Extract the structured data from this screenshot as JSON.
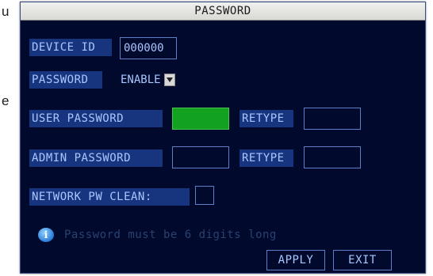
{
  "background_text": [
    "u",
    "e"
  ],
  "dialog": {
    "title": "PASSWORD",
    "device_id": {
      "label": "DEVICE ID",
      "value": "000000"
    },
    "password": {
      "label": "PASSWORD",
      "selected": "ENABLE"
    },
    "user_password": {
      "label": "USER PASSWORD",
      "retype_label": "RETYPE"
    },
    "admin_password": {
      "label": "ADMIN PASSWORD",
      "retype_label": "RETYPE"
    },
    "network_pw_clean": {
      "label": "NETWORK PW CLEAN:"
    },
    "info": {
      "icon": "info-icon",
      "glyph": "i",
      "text": "Password must be 6 digits long"
    },
    "buttons": {
      "apply": "APPLY",
      "exit": "EXIT"
    }
  },
  "colors": {
    "dialog_background": "#010a2c",
    "label_background": "#17357e",
    "label_text": "#a9c6ff",
    "active_field": "#12a21f",
    "info_text": "#2a4170"
  }
}
